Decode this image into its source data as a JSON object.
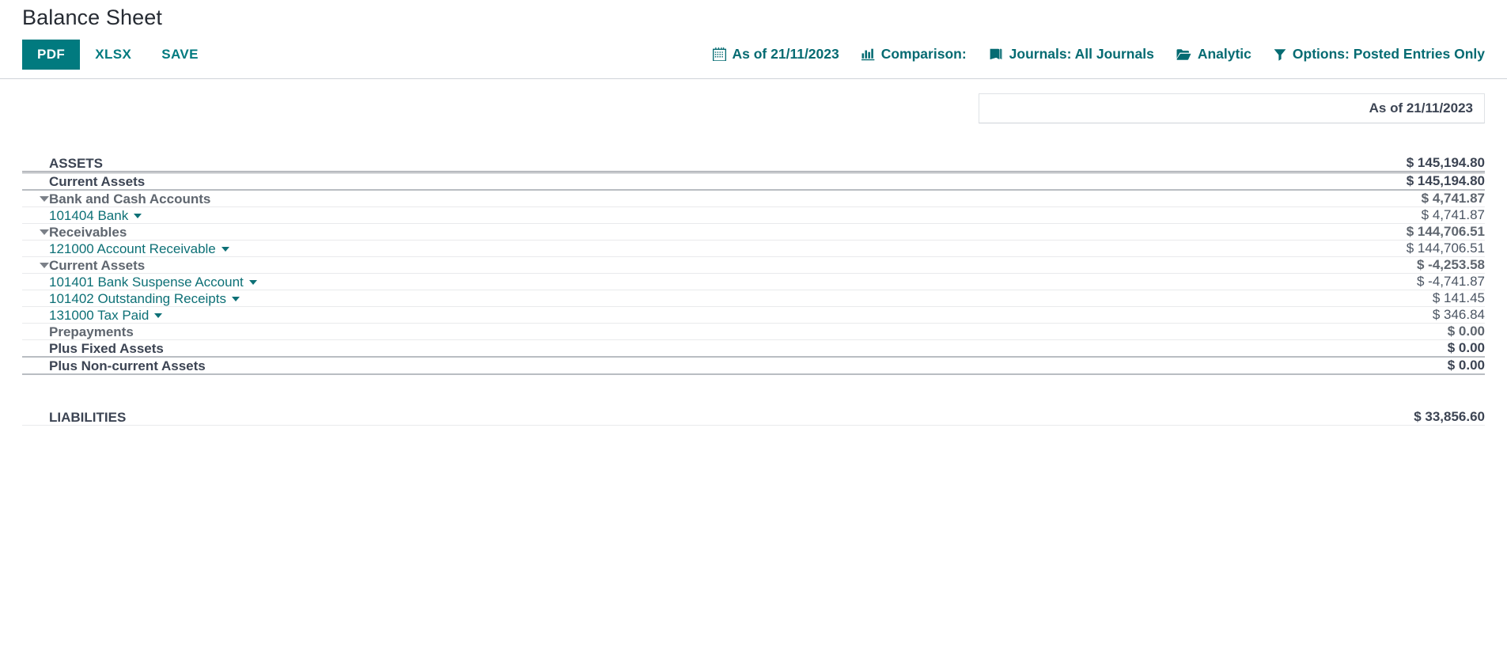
{
  "page": {
    "title": "Balance Sheet",
    "accent": "#017a7f",
    "link_color": "#0d7076",
    "text_color": "#3c4453"
  },
  "toolbar": {
    "buttons": [
      {
        "label": "PDF",
        "style": "primary"
      },
      {
        "label": "XLSX",
        "style": "flat"
      },
      {
        "label": "SAVE",
        "style": "flat"
      }
    ],
    "filters": [
      {
        "icon": "calendar-icon",
        "label": "As of 21/11/2023"
      },
      {
        "icon": "bar-chart-icon",
        "label": "Comparison:"
      },
      {
        "icon": "book-icon",
        "label": "Journals: All Journals"
      },
      {
        "icon": "folder-open-icon",
        "label": "Analytic"
      },
      {
        "icon": "filter-icon",
        "label": "Options: Posted Entries Only"
      }
    ]
  },
  "table": {
    "column_header": "As of 21/11/2023",
    "rows": [
      {
        "id": "assets",
        "label": "ASSETS",
        "amount": "$ 145,194.80",
        "level": "head",
        "caret": "none",
        "border": "double"
      },
      {
        "id": "current-assets-1",
        "label": "Current Assets",
        "amount": "$ 145,194.80",
        "level": "1",
        "caret": "none",
        "border": "med"
      },
      {
        "id": "bank-and-cash",
        "label": "Bank and Cash Accounts",
        "amount": "$ 4,741.87",
        "level": "2",
        "caret": "expanded",
        "border": "thin"
      },
      {
        "id": "101404-bank",
        "label": "101404 Bank",
        "amount": "$ 4,741.87",
        "level": "3",
        "caret": "none",
        "border": "thin"
      },
      {
        "id": "receivables",
        "label": "Receivables",
        "amount": "$ 144,706.51",
        "level": "2",
        "caret": "expanded",
        "border": "thin"
      },
      {
        "id": "121000-account-receivable",
        "label": "121000 Account Receivable",
        "amount": "$ 144,706.51",
        "level": "3",
        "caret": "none",
        "border": "thin"
      },
      {
        "id": "current-assets-2",
        "label": "Current Assets",
        "amount": "$ -4,253.58",
        "level": "2",
        "caret": "expanded",
        "border": "thin"
      },
      {
        "id": "101401-bank-suspense",
        "label": "101401 Bank Suspense Account",
        "amount": "$ -4,741.87",
        "level": "3",
        "caret": "none",
        "border": "thin"
      },
      {
        "id": "101402-outstanding-receipts",
        "label": "101402 Outstanding Receipts",
        "amount": "$ 141.45",
        "level": "3",
        "caret": "none",
        "border": "thin"
      },
      {
        "id": "131000-tax-paid",
        "label": "131000 Tax Paid",
        "amount": "$ 346.84",
        "level": "3",
        "caret": "none",
        "border": "thin"
      },
      {
        "id": "prepayments",
        "label": "Prepayments",
        "amount": "$ 0.00",
        "level": "2",
        "caret": "none",
        "border": "thin"
      },
      {
        "id": "plus-fixed-assets",
        "label": "Plus Fixed Assets",
        "amount": "$ 0.00",
        "level": "1",
        "caret": "none",
        "border": "med"
      },
      {
        "id": "plus-non-current-assets",
        "label": "Plus Non-current Assets",
        "amount": "$ 0.00",
        "level": "1",
        "caret": "none",
        "border": "med"
      },
      {
        "id": "spacer",
        "label": "",
        "amount": "",
        "level": "spacer",
        "caret": "none",
        "border": "none"
      },
      {
        "id": "liabilities",
        "label": "LIABILITIES",
        "amount": "$ 33,856.60",
        "level": "head",
        "caret": "none",
        "border": "thin"
      }
    ]
  }
}
